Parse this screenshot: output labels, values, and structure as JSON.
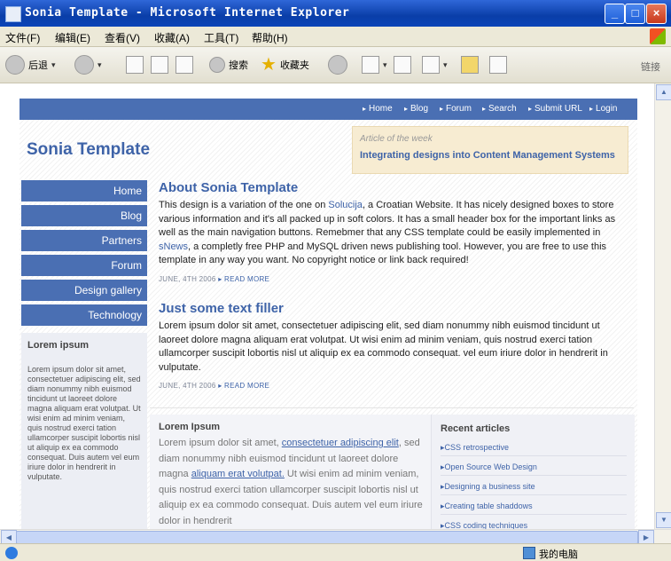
{
  "window": {
    "title": "Sonia Template - Microsoft Internet Explorer"
  },
  "menu": [
    "文件(F)",
    "编辑(E)",
    "查看(V)",
    "收藏(A)",
    "工具(T)",
    "帮助(H)"
  ],
  "toolbar": {
    "back": "后退",
    "search": "搜索",
    "favorites": "收藏夹",
    "links": "链接"
  },
  "page": {
    "nav": [
      "Home",
      "Blog",
      "Forum",
      "Search",
      "Submit URL",
      "Login"
    ],
    "site_title": "Sonia Template",
    "aotw": {
      "kicker": "Article of the week",
      "headline": "Integrating designs into Content Management Systems"
    },
    "sidebar": {
      "items": [
        "Home",
        "Blog",
        "Partners",
        "Forum",
        "Design gallery",
        "Technology"
      ],
      "box_title": "Lorem ipsum",
      "box_text": "Lorem ipsum dolor sit amet, consectetuer adipiscing elit, sed diam nonummy nibh euismod tincidunt ut laoreet dolore magna aliquam erat volutpat. Ut wisi enim ad minim veniam, quis nostrud exerci tation ullamcorper suscipit lobortis nisl ut aliquip ex ea commodo consequat. Duis autem vel eum iriure dolor in hendrerit in vulputate."
    },
    "article1": {
      "title": "About Sonia Template",
      "p1": "This design is a variation of the one on ",
      "link1": "Solucija",
      "p2": ", a Croatian Website. It has nicely designed boxes to store various information and it's all packed up in soft colors. It has a small header box for the important links as well as the main navigation buttons. Remebmer that any CSS template could be easily implemented in ",
      "link2": "sNews",
      "p3": ", a completly free PHP and MySQL driven news publishing tool. However, you are free to use this template in any way you want. No copyright notice or link back required!",
      "date": "JUNE, 4TH 2006 ",
      "more": "▸ READ MORE"
    },
    "article2": {
      "title": "Just some text filler",
      "body": "Lorem ipsum dolor sit amet, consectetuer adipiscing elit, sed diam nonummy nibh euismod tincidunt ut laoreet dolore magna aliquam erat volutpat. Ut wisi enim ad minim veniam, quis nostrud exerci tation ullamcorper suscipit lobortis nisl ut aliquip ex ea commodo consequat. vel eum iriure dolor in hendrerit in vulputate.",
      "date": "JUNE, 4TH 2006 ",
      "more": "▸ READ MORE"
    },
    "bottom_left": {
      "title": "Lorem Ipsum",
      "t1": "Lorem ipsum dolor sit amet, ",
      "u1": "consectetuer adipiscing elit",
      "t2": ", sed diam nonummy nibh euismod tincidunt ut laoreet dolore magna ",
      "u2": "aliquam erat volutpat.",
      "t3": " Ut wisi enim ad minim veniam, quis nostrud exerci tation ullamcorper suscipit lobortis nisl ut aliquip ex ea commodo consequat. Duis autem vel eum iriure dolor in hendrerit"
    },
    "recent": {
      "title": "Recent articles",
      "items": [
        "CSS retrospective",
        "Open Source Web Design",
        "Designing a business site",
        "Creating table shaddows",
        "CSS coding techniques"
      ]
    }
  },
  "status": {
    "zone": "我的电脑"
  }
}
